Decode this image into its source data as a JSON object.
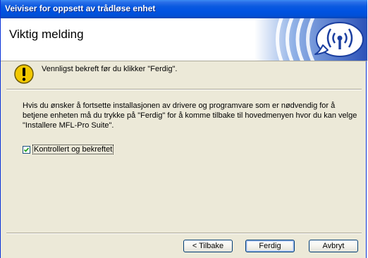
{
  "window": {
    "title": "Veiviser for oppsett av trådløse enhet"
  },
  "header": {
    "title": "Viktig melding",
    "logo_icon": "wireless-signal-icon"
  },
  "warning": {
    "icon": "exclamation-warning-icon",
    "text": "Vennligst bekreft før du klikker \"Ferdig\"."
  },
  "body": {
    "text": "Hvis du ønsker å fortsette installasjonen av drivere og programvare som er nødvendig for å betjene enheten må du trykke på \"Ferdig\" for å komme tilbake til hovedmenyen hvor du kan velge \"Installere MFL-Pro Suite\"."
  },
  "confirm_checkbox": {
    "label": "Kontrollert og bekreftet",
    "checked": true
  },
  "buttons": {
    "back": "< Tilbake",
    "finish": "Ferdig",
    "cancel": "Avbryt"
  },
  "colors": {
    "titlebar": "#0053e1",
    "dialog_bg": "#ece9d8",
    "logo_blue": "#1b3fa0",
    "warning_yellow": "#f2c800"
  }
}
